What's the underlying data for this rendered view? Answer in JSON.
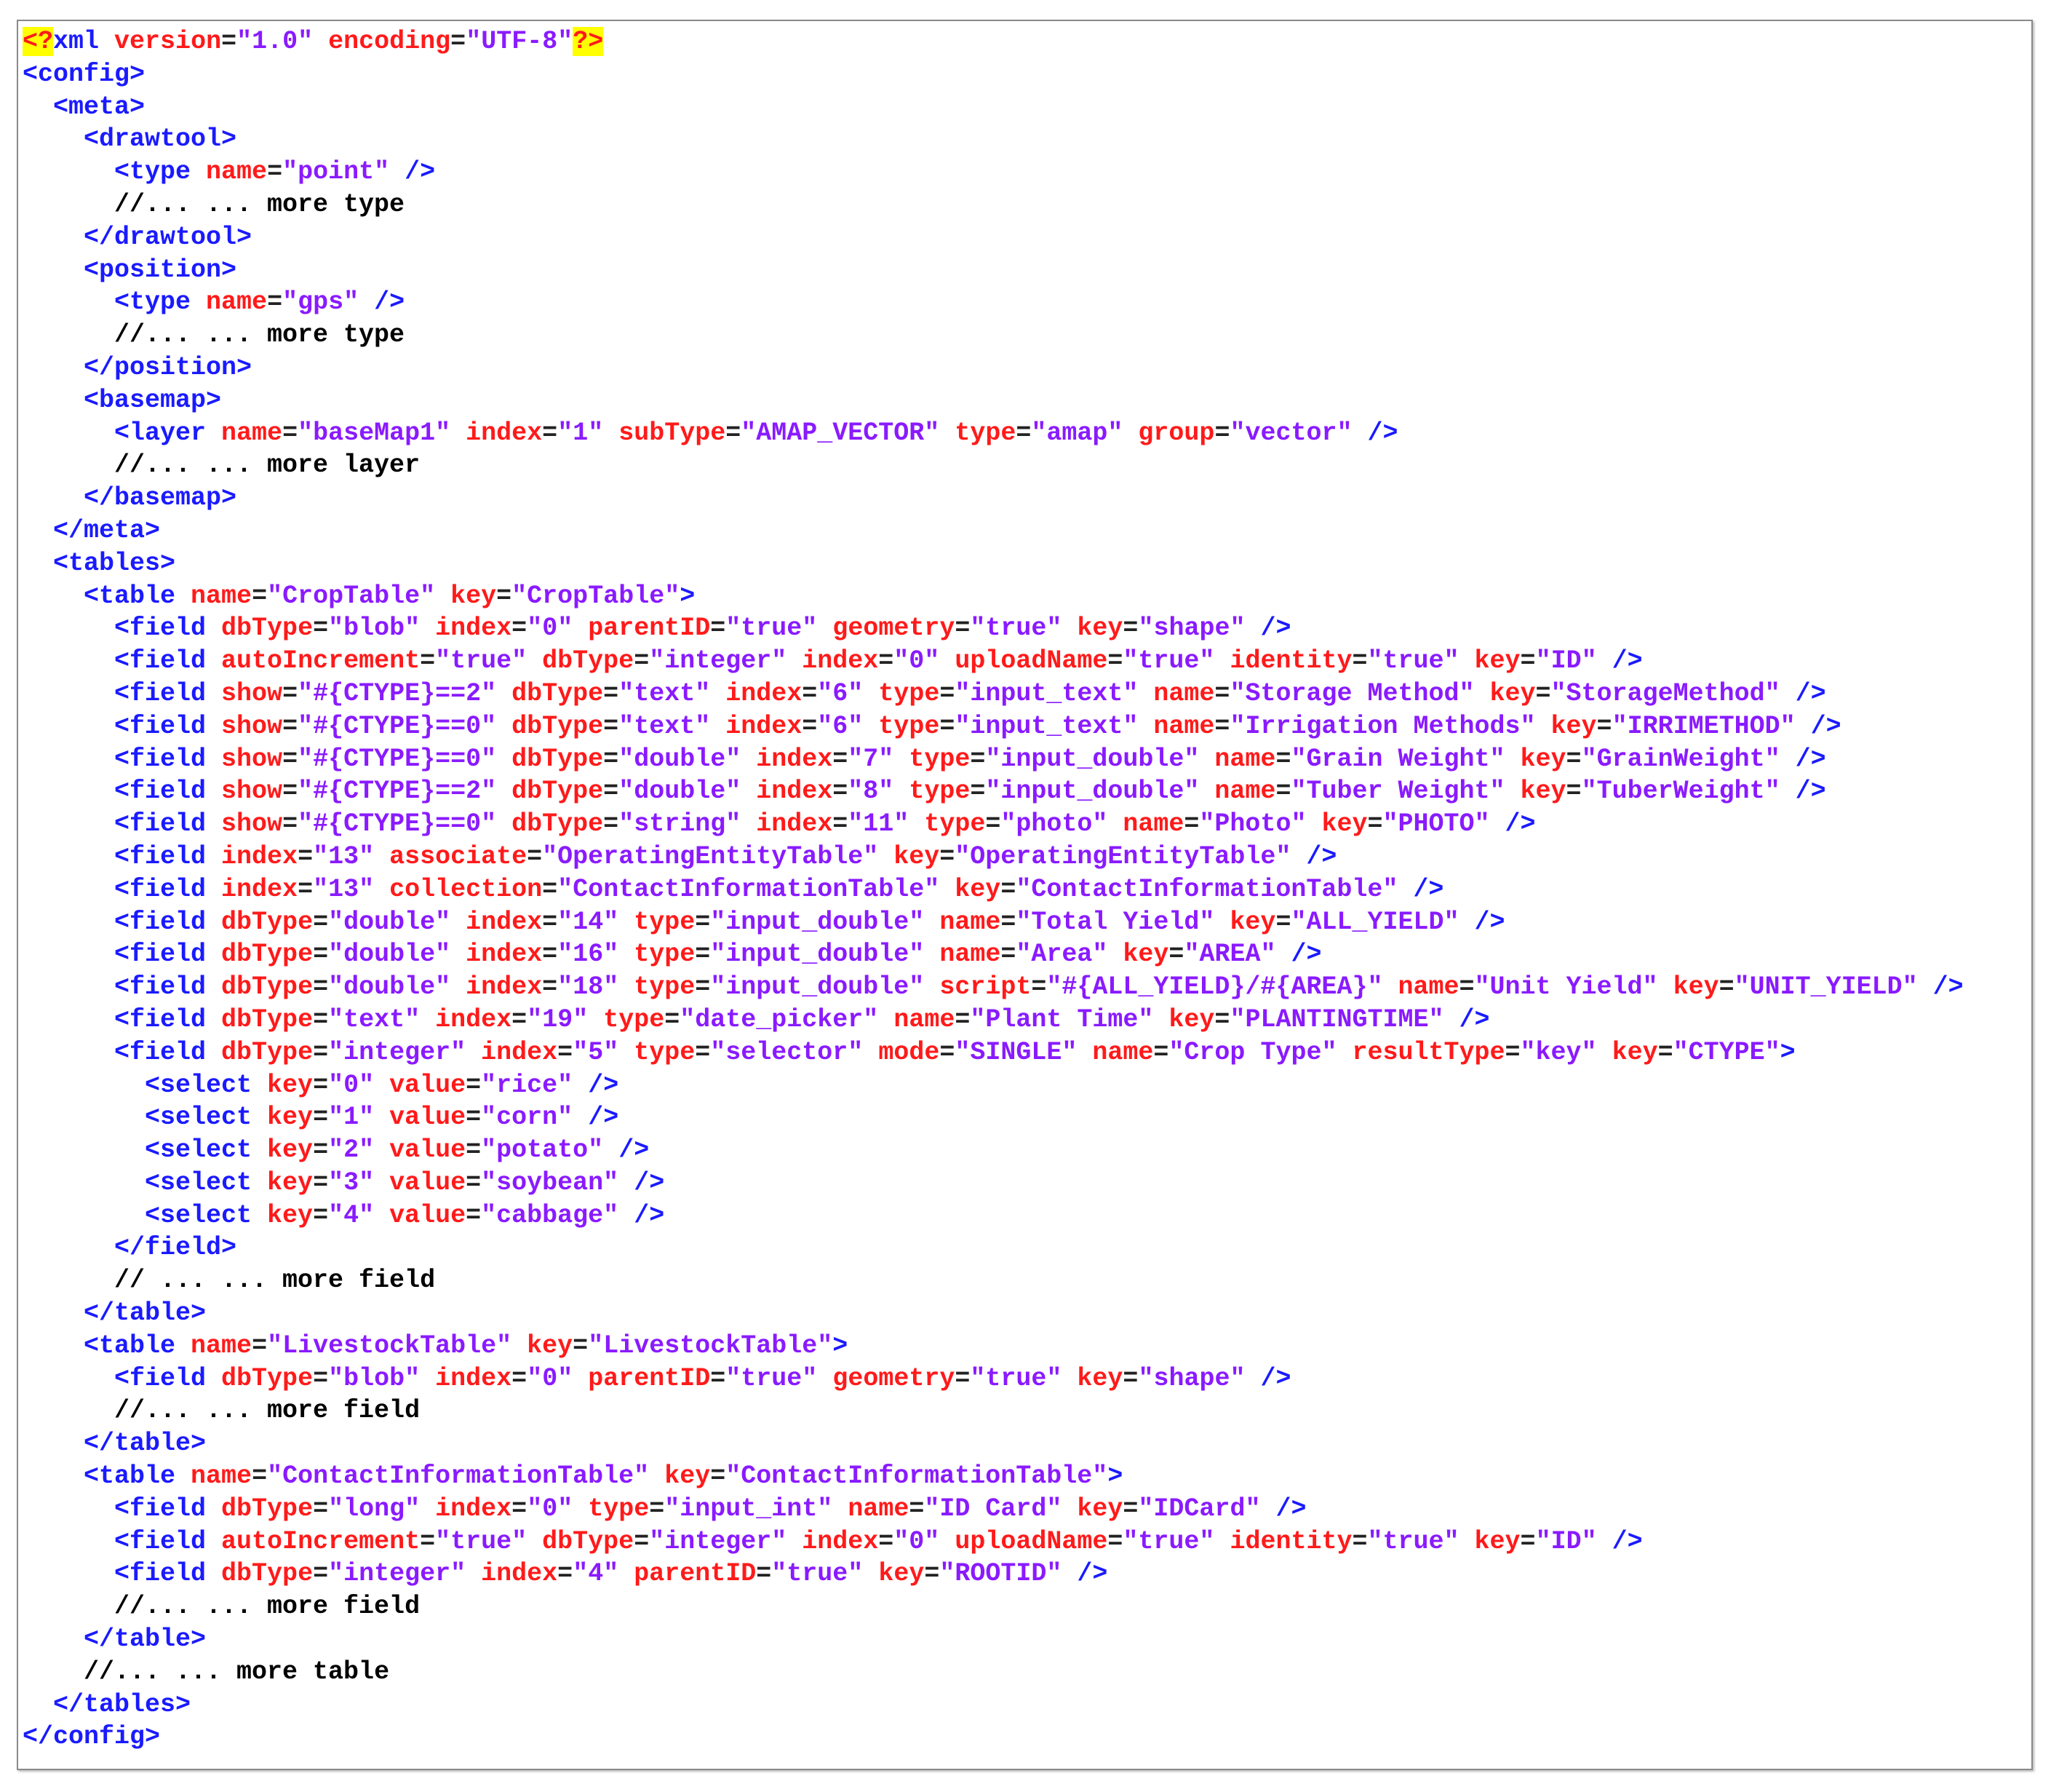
{
  "lines": [
    {
      "i": 0,
      "pi_open": "<?",
      "open": "xml",
      "attrs": [
        {
          "n": "version",
          "v": "\"1.0\""
        },
        {
          "n": "encoding",
          "v": "\"UTF-8\""
        }
      ],
      "pi_close": "?>"
    },
    {
      "i": 0,
      "open": "<config>"
    },
    {
      "i": 1,
      "open": "<meta>"
    },
    {
      "i": 2,
      "open": "<drawtool>"
    },
    {
      "i": 3,
      "open": "<type",
      "attrs": [
        {
          "n": "name",
          "v": "\"point\""
        }
      ],
      "end": " />"
    },
    {
      "i": 3,
      "comment": "//... ... more type"
    },
    {
      "i": 2,
      "open": "</drawtool>"
    },
    {
      "i": 2,
      "open": "<position>"
    },
    {
      "i": 3,
      "open": "<type",
      "attrs": [
        {
          "n": "name",
          "v": "\"gps\""
        }
      ],
      "end": " />"
    },
    {
      "i": 3,
      "comment": "//... ... more type"
    },
    {
      "i": 2,
      "open": "</position>"
    },
    {
      "i": 2,
      "open": "<basemap>"
    },
    {
      "i": 3,
      "open": "<layer",
      "attrs": [
        {
          "n": "name",
          "v": "\"baseMap1\""
        },
        {
          "n": "index",
          "v": "\"1\""
        },
        {
          "n": "subType",
          "v": "\"AMAP_VECTOR\""
        },
        {
          "n": "type",
          "v": "\"amap\""
        },
        {
          "n": "group",
          "v": "\"vector\""
        }
      ],
      "end": " />"
    },
    {
      "i": 3,
      "comment": "//... ... more layer"
    },
    {
      "i": 2,
      "open": "</basemap>"
    },
    {
      "i": 1,
      "open": "</meta>"
    },
    {
      "i": 1,
      "open": "<tables>"
    },
    {
      "i": 2,
      "open": "<table",
      "attrs": [
        {
          "n": "name",
          "v": "\"CropTable\""
        },
        {
          "n": "key",
          "v": "\"CropTable\""
        }
      ],
      "end": ">"
    },
    {
      "i": 3,
      "open": "<field",
      "attrs": [
        {
          "n": "dbType",
          "v": "\"blob\""
        },
        {
          "n": "index",
          "v": "\"0\""
        },
        {
          "n": "parentID",
          "v": "\"true\""
        },
        {
          "n": "geometry",
          "v": "\"true\""
        },
        {
          "n": "key",
          "v": "\"shape\""
        }
      ],
      "end": " />"
    },
    {
      "i": 3,
      "open": "<field",
      "attrs": [
        {
          "n": "autoIncrement",
          "v": "\"true\""
        },
        {
          "n": "dbType",
          "v": "\"integer\""
        },
        {
          "n": "index",
          "v": "\"0\""
        },
        {
          "n": "uploadName",
          "v": "\"true\""
        },
        {
          "n": "identity",
          "v": "\"true\""
        },
        {
          "n": "key",
          "v": "\"ID\""
        }
      ],
      "end": " />"
    },
    {
      "i": 3,
      "open": "<field",
      "attrs": [
        {
          "n": "show",
          "v": "\"#{CTYPE}==2\""
        },
        {
          "n": "dbType",
          "v": "\"text\""
        },
        {
          "n": "index",
          "v": "\"6\""
        },
        {
          "n": "type",
          "v": "\"input_text\""
        },
        {
          "n": "name",
          "v": "\"Storage Method\""
        },
        {
          "n": "key",
          "v": "\"StorageMethod\""
        }
      ],
      "end": " />"
    },
    {
      "i": 3,
      "open": "<field",
      "attrs": [
        {
          "n": "show",
          "v": "\"#{CTYPE}==0\""
        },
        {
          "n": "dbType",
          "v": "\"text\""
        },
        {
          "n": "index",
          "v": "\"6\""
        },
        {
          "n": "type",
          "v": "\"input_text\""
        },
        {
          "n": "name",
          "v": "\"Irrigation Methods\""
        },
        {
          "n": "key",
          "v": "\"IRRIMETHOD\""
        }
      ],
      "end": " />"
    },
    {
      "i": 3,
      "open": "<field",
      "attrs": [
        {
          "n": "show",
          "v": "\"#{CTYPE}==0\""
        },
        {
          "n": "dbType",
          "v": "\"double\""
        },
        {
          "n": "index",
          "v": "\"7\""
        },
        {
          "n": "type",
          "v": "\"input_double\""
        },
        {
          "n": "name",
          "v": "\"Grain Weight\""
        },
        {
          "n": "key",
          "v": "\"GrainWeight\""
        }
      ],
      "end": " />"
    },
    {
      "i": 3,
      "open": "<field",
      "attrs": [
        {
          "n": "show",
          "v": "\"#{CTYPE}==2\""
        },
        {
          "n": "dbType",
          "v": "\"double\""
        },
        {
          "n": "index",
          "v": "\"8\""
        },
        {
          "n": "type",
          "v": "\"input_double\""
        },
        {
          "n": "name",
          "v": "\"Tuber Weight\""
        },
        {
          "n": "key",
          "v": "\"TuberWeight\""
        }
      ],
      "end": " />"
    },
    {
      "i": 3,
      "open": "<field",
      "attrs": [
        {
          "n": "show",
          "v": "\"#{CTYPE}==0\""
        },
        {
          "n": "dbType",
          "v": "\"string\""
        },
        {
          "n": "index",
          "v": "\"11\""
        },
        {
          "n": "type",
          "v": "\"photo\""
        },
        {
          "n": "name",
          "v": "\"Photo\""
        },
        {
          "n": "key",
          "v": "\"PHOTO\""
        }
      ],
      "end": " />"
    },
    {
      "i": 3,
      "open": "<field",
      "attrs": [
        {
          "n": "index",
          "v": "\"13\""
        },
        {
          "n": "associate",
          "v": "\"OperatingEntityTable\""
        },
        {
          "n": "key",
          "v": "\"OperatingEntityTable\""
        }
      ],
      "end": " />"
    },
    {
      "i": 3,
      "open": "<field",
      "attrs": [
        {
          "n": "index",
          "v": "\"13\""
        },
        {
          "n": "collection",
          "v": "\"ContactInformationTable\""
        },
        {
          "n": "key",
          "v": "\"ContactInformationTable\""
        }
      ],
      "end": " />"
    },
    {
      "i": 3,
      "open": "<field",
      "attrs": [
        {
          "n": "dbType",
          "v": "\"double\""
        },
        {
          "n": "index",
          "v": "\"14\""
        },
        {
          "n": "type",
          "v": "\"input_double\""
        },
        {
          "n": "name",
          "v": "\"Total Yield\""
        },
        {
          "n": "key",
          "v": "\"ALL_YIELD\""
        }
      ],
      "end": " />"
    },
    {
      "i": 3,
      "open": "<field",
      "attrs": [
        {
          "n": "dbType",
          "v": "\"double\""
        },
        {
          "n": "index",
          "v": "\"16\""
        },
        {
          "n": "type",
          "v": "\"input_double\""
        },
        {
          "n": "name",
          "v": "\"Area\""
        },
        {
          "n": "key",
          "v": "\"AREA\""
        }
      ],
      "end": " />"
    },
    {
      "i": 3,
      "open": "<field",
      "attrs": [
        {
          "n": "dbType",
          "v": "\"double\""
        },
        {
          "n": "index",
          "v": "\"18\""
        },
        {
          "n": "type",
          "v": "\"input_double\""
        },
        {
          "n": "script",
          "v": "\"#{ALL_YIELD}/#{AREA}\""
        },
        {
          "n": "name",
          "v": "\"Unit Yield\""
        },
        {
          "n": "key",
          "v": "\"UNIT_YIELD\""
        }
      ],
      "end": " />"
    },
    {
      "i": 3,
      "open": "<field",
      "attrs": [
        {
          "n": "dbType",
          "v": "\"text\""
        },
        {
          "n": "index",
          "v": "\"19\""
        },
        {
          "n": "type",
          "v": "\"date_picker\""
        },
        {
          "n": "name",
          "v": "\"Plant Time\""
        },
        {
          "n": "key",
          "v": "\"PLANTINGTIME\""
        }
      ],
      "end": " />"
    },
    {
      "i": 3,
      "open": "<field",
      "attrs": [
        {
          "n": "dbType",
          "v": "\"integer\""
        },
        {
          "n": "index",
          "v": "\"5\""
        },
        {
          "n": "type",
          "v": "\"selector\""
        },
        {
          "n": "mode",
          "v": "\"SINGLE\""
        },
        {
          "n": "name",
          "v": "\"Crop Type\""
        },
        {
          "n": "resultType",
          "v": "\"key\""
        },
        {
          "n": "key",
          "v": "\"CTYPE\""
        }
      ],
      "end": ">"
    },
    {
      "i": 4,
      "open": "<select",
      "attrs": [
        {
          "n": "key",
          "v": "\"0\""
        },
        {
          "n": "value",
          "v": "\"rice\""
        }
      ],
      "end": " />"
    },
    {
      "i": 4,
      "open": "<select",
      "attrs": [
        {
          "n": "key",
          "v": "\"1\""
        },
        {
          "n": "value",
          "v": "\"corn\""
        }
      ],
      "end": " />"
    },
    {
      "i": 4,
      "open": "<select",
      "attrs": [
        {
          "n": "key",
          "v": "\"2\""
        },
        {
          "n": "value",
          "v": "\"potato\""
        }
      ],
      "end": " />"
    },
    {
      "i": 4,
      "open": "<select",
      "attrs": [
        {
          "n": "key",
          "v": "\"3\""
        },
        {
          "n": "value",
          "v": "\"soybean\""
        }
      ],
      "end": " />"
    },
    {
      "i": 4,
      "open": "<select",
      "attrs": [
        {
          "n": "key",
          "v": "\"4\""
        },
        {
          "n": "value",
          "v": "\"cabbage\""
        }
      ],
      "end": " />"
    },
    {
      "i": 3,
      "open": "</field>"
    },
    {
      "i": 3,
      "comment": "// ... ... more field"
    },
    {
      "i": 2,
      "open": "</table>"
    },
    {
      "i": 2,
      "open": "<table",
      "attrs": [
        {
          "n": "name",
          "v": "\"LivestockTable\""
        },
        {
          "n": "key",
          "v": "\"LivestockTable\""
        }
      ],
      "end": ">"
    },
    {
      "i": 3,
      "open": "<field",
      "attrs": [
        {
          "n": "dbType",
          "v": "\"blob\""
        },
        {
          "n": "index",
          "v": "\"0\""
        },
        {
          "n": "parentID",
          "v": "\"true\""
        },
        {
          "n": "geometry",
          "v": "\"true\""
        },
        {
          "n": "key",
          "v": "\"shape\""
        }
      ],
      "end": " />"
    },
    {
      "i": 3,
      "comment": "//... ... more field"
    },
    {
      "i": 2,
      "open": "</table>"
    },
    {
      "i": 2,
      "open": "<table",
      "attrs": [
        {
          "n": "name",
          "v": "\"ContactInformationTable\""
        },
        {
          "n": "key",
          "v": "\"ContactInformationTable\""
        }
      ],
      "end": ">"
    },
    {
      "i": 3,
      "open": "<field",
      "attrs": [
        {
          "n": "dbType",
          "v": "\"long\""
        },
        {
          "n": "index",
          "v": "\"0\""
        },
        {
          "n": "type",
          "v": "\"input_int\""
        },
        {
          "n": "name",
          "v": "\"ID Card\""
        },
        {
          "n": "key",
          "v": "\"IDCard\""
        }
      ],
      "end": " />"
    },
    {
      "i": 3,
      "open": "<field",
      "attrs": [
        {
          "n": "autoIncrement",
          "v": "\"true\""
        },
        {
          "n": "dbType",
          "v": "\"integer\""
        },
        {
          "n": "index",
          "v": "\"0\""
        },
        {
          "n": "uploadName",
          "v": "\"true\""
        },
        {
          "n": "identity",
          "v": "\"true\""
        },
        {
          "n": "key",
          "v": "\"ID\""
        }
      ],
      "end": " />"
    },
    {
      "i": 3,
      "open": "<field",
      "attrs": [
        {
          "n": "dbType",
          "v": "\"integer\""
        },
        {
          "n": "index",
          "v": "\"4\""
        },
        {
          "n": "parentID",
          "v": "\"true\""
        },
        {
          "n": "key",
          "v": "\"ROOTID\""
        }
      ],
      "end": " />"
    },
    {
      "i": 3,
      "comment": "//... ... more field"
    },
    {
      "i": 2,
      "open": "</table>"
    },
    {
      "i": 2,
      "comment": "//... ... more table"
    },
    {
      "i": 1,
      "open": "</tables>"
    },
    {
      "i": 0,
      "open": "</config>"
    }
  ]
}
